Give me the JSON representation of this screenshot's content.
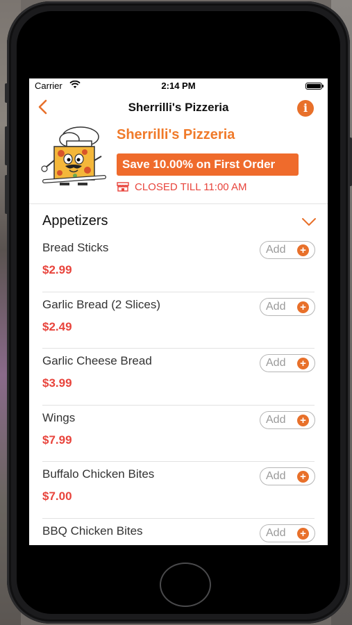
{
  "status_bar": {
    "carrier": "Carrier",
    "time": "2:14 PM"
  },
  "nav": {
    "title": "Sherrilli's Pizzeria",
    "back_icon": "chevron-left-icon",
    "info_icon": "info-icon"
  },
  "restaurant": {
    "name": "Sherrilli's Pizzeria",
    "promo": "Save 10.00% on First Order",
    "status": "CLOSED TILL 11:00 AM"
  },
  "section": {
    "title": "Appetizers"
  },
  "menu_items": [
    {
      "name": "Bread Sticks",
      "price": "$2.99",
      "add_label": "Add"
    },
    {
      "name": "Garlic Bread (2 Slices)",
      "price": "$2.49",
      "add_label": "Add"
    },
    {
      "name": "Garlic Cheese Bread",
      "price": "$3.99",
      "add_label": "Add"
    },
    {
      "name": "Wings",
      "price": "$7.99",
      "add_label": "Add"
    },
    {
      "name": "Buffalo Chicken Bites",
      "price": "$7.00",
      "add_label": "Add"
    },
    {
      "name": "BBQ Chicken Bites",
      "price": "",
      "add_label": "Add"
    }
  ],
  "colors": {
    "accent": "#ef6b2c",
    "price": "#e8443c"
  }
}
